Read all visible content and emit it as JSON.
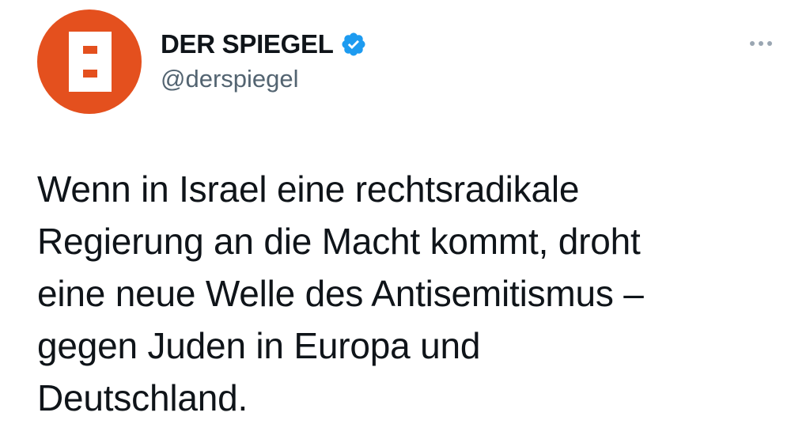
{
  "author": {
    "display_name": "DER SPIEGEL",
    "handle": "@derspiegel",
    "avatar_icon": "spiegel-s-logo-icon",
    "avatar_color": "#e4501e",
    "verified": true,
    "verified_icon": "verified-badge-icon",
    "verified_color": "#1d9bf0"
  },
  "tweet": {
    "text": "Wenn in Israel eine rechtsradikale\nRegierung an die Macht kommt, droht\neine neue Welle des Antisemitismus –\ngegen Juden in Europa und\nDeutschland."
  },
  "menu": {
    "icon": "more-options-icon"
  }
}
